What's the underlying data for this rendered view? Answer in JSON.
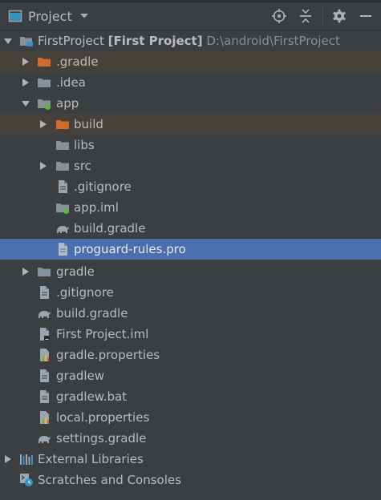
{
  "header": {
    "title": "Project",
    "tools": [
      "target-icon",
      "collapse-icon",
      "gear-icon",
      "minimize-icon"
    ]
  },
  "tree": {
    "root": {
      "name": "FirstProject",
      "module": "[First Project]",
      "path": "D:\\android\\FirstProject"
    },
    "items": [
      {
        "label": ".gradle",
        "icon": "folder-orange-icon"
      },
      {
        "label": ".idea",
        "icon": "folder-icon"
      },
      {
        "label": "app",
        "icon": "module-folder-icon"
      },
      {
        "label": "build",
        "icon": "folder-orange-icon"
      },
      {
        "label": "libs",
        "icon": "folder-icon"
      },
      {
        "label": "src",
        "icon": "folder-icon"
      },
      {
        "label": ".gitignore",
        "icon": "file-icon"
      },
      {
        "label": "app.iml",
        "icon": "module-file-icon"
      },
      {
        "label": "build.gradle",
        "icon": "gradle-icon"
      },
      {
        "label": "proguard-rules.pro",
        "icon": "file-icon"
      },
      {
        "label": "gradle",
        "icon": "folder-icon"
      },
      {
        "label": ".gitignore",
        "icon": "file-icon"
      },
      {
        "label": "build.gradle",
        "icon": "gradle-icon"
      },
      {
        "label": "First Project.iml",
        "icon": "iml-file-icon"
      },
      {
        "label": "gradle.properties",
        "icon": "properties-icon"
      },
      {
        "label": "gradlew",
        "icon": "file-icon"
      },
      {
        "label": "gradlew.bat",
        "icon": "file-icon"
      },
      {
        "label": "local.properties",
        "icon": "properties-icon"
      },
      {
        "label": "settings.gradle",
        "icon": "gradle-icon"
      },
      {
        "label": "External Libraries",
        "icon": "libraries-icon"
      },
      {
        "label": "Scratches and Consoles",
        "icon": "scratches-icon"
      }
    ]
  },
  "colors": {
    "background": "#3c3f41",
    "selection": "#4b6eaf",
    "excluded_tint": "#45403a",
    "folder": "#87939a",
    "folder_excluded": "#d16a2a"
  }
}
